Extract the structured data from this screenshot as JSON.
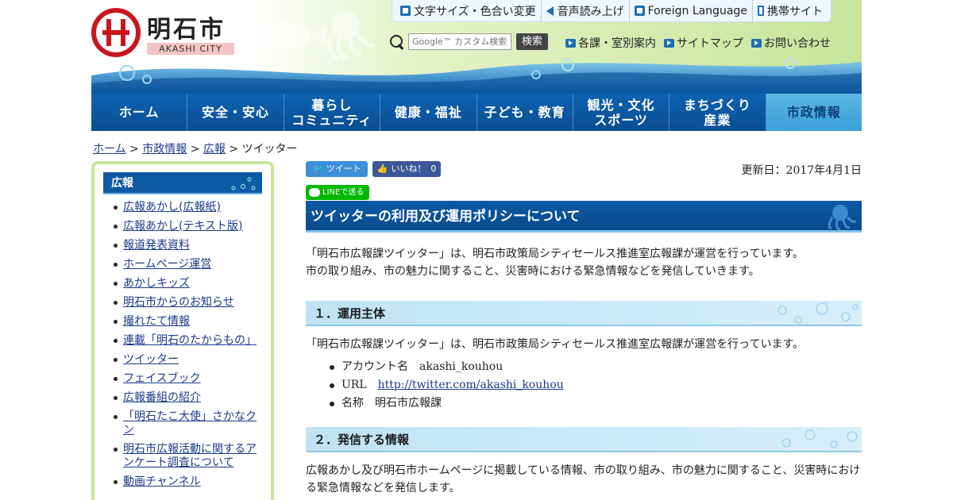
{
  "header": {
    "city_name": "明石市",
    "city_sub": "AKASHI CITY",
    "util_links": [
      "文字サイズ・色合い変更",
      "音声読み上げ",
      "Foreign Language",
      "携帯サイト"
    ],
    "search": {
      "placeholder": "Google™ カスタム検索",
      "button": "検索"
    },
    "sub_links": [
      "各課・室別案内",
      "サイトマップ",
      "お問い合わせ"
    ]
  },
  "nav": {
    "items": [
      {
        "label": "ホーム"
      },
      {
        "label": "安全・安心"
      },
      {
        "label": "暮らし\nコミュニティ"
      },
      {
        "label": "健康・福祉"
      },
      {
        "label": "子ども・教育"
      },
      {
        "label": "観光・文化\nスポーツ"
      },
      {
        "label": "まちづくり\n産業"
      },
      {
        "label": "市政情報"
      }
    ]
  },
  "breadcrumb": {
    "items": [
      "ホーム",
      "市政情報",
      "広報"
    ],
    "separator": ">",
    "current": "ツイッター"
  },
  "sidebar": {
    "title": "広報",
    "items": [
      "広報あかし(広報紙)",
      "広報あかし(テキスト版)",
      "報道発表資料",
      "ホームページ運営",
      "あかしキッズ",
      "明石市からのお知らせ",
      "撮れたて情報",
      "連載「明石のたからもの」",
      "ツイッター",
      "フェイスブック",
      "広報番組の紹介",
      "「明石たこ大使」さかなクン",
      "明石市広報活動に関するアンケート調査について",
      "動画チャンネル"
    ]
  },
  "main": {
    "tweet_label": "ツイート",
    "like_label": "いいね！",
    "like_count": "0",
    "line_label": "LINEで送る",
    "updated": "更新日：2017年4月1日",
    "title": "ツイッターの利用及び運用ポリシーについて",
    "intro": [
      "「明石市広報課ツイッター」は、明石市政策局シティセールス推進室広報課が運営を行っています。",
      "市の取り組み、市の魅力に関すること、災害時における緊急情報などを発信していきます。"
    ],
    "section1": {
      "heading": "１．運用主体",
      "text": "「明石市広報課ツイッター」は、明石市政策局シティセールス推進室広報課が運営を行っています。",
      "account_label": "アカウント名",
      "account_value": "akashi_kouhou",
      "url_label": "URL",
      "url_value": "http://twitter.com/akashi_kouhou",
      "name_label": "名称",
      "name_value": "明石市広報課"
    },
    "section2": {
      "heading": "２．発信する情報",
      "text1": "広報あかし及び明石市ホームページに掲載している情報、市の取り組み、市の魅力に関すること、災害時におけ",
      "text2": "る緊急情報などを発信します。"
    }
  },
  "colors": {
    "nav_blue": "#0d63b0",
    "nav_active": "#3a9fd8",
    "heading_blue": "#0d5aa5",
    "sidebar_border": "#c8e59a",
    "logo_red": "#c8161d"
  }
}
